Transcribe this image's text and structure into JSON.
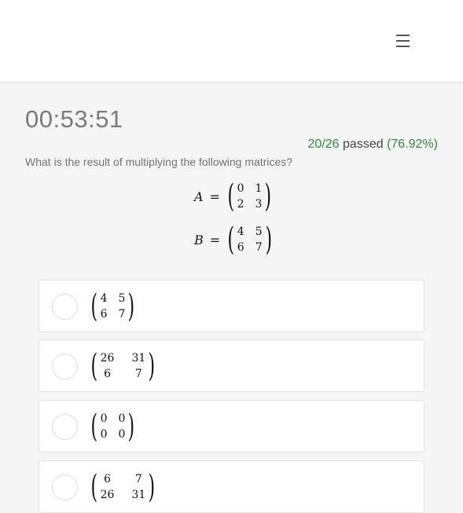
{
  "header": {
    "menu_icon": "hamburger-menu-icon"
  },
  "timer": "00:53:51",
  "score": {
    "fraction": "20/26",
    "passed_label": "passed",
    "percent": "(76.92%)"
  },
  "question": {
    "text": "What is the result of multiplying the following matrices?",
    "matrix_a": {
      "name": "A",
      "equals": "=",
      "cells": [
        "0",
        "1",
        "2",
        "3"
      ]
    },
    "matrix_b": {
      "name": "B",
      "equals": "=",
      "cells": [
        "4",
        "5",
        "6",
        "7"
      ]
    }
  },
  "options": [
    {
      "cells": [
        "4",
        "5",
        "6",
        "7"
      ]
    },
    {
      "cells": [
        "26",
        "31",
        "6",
        "7"
      ]
    },
    {
      "cells": [
        "0",
        "0",
        "0",
        "0"
      ]
    },
    {
      "cells": [
        "6",
        "7",
        "26",
        "31"
      ]
    }
  ]
}
